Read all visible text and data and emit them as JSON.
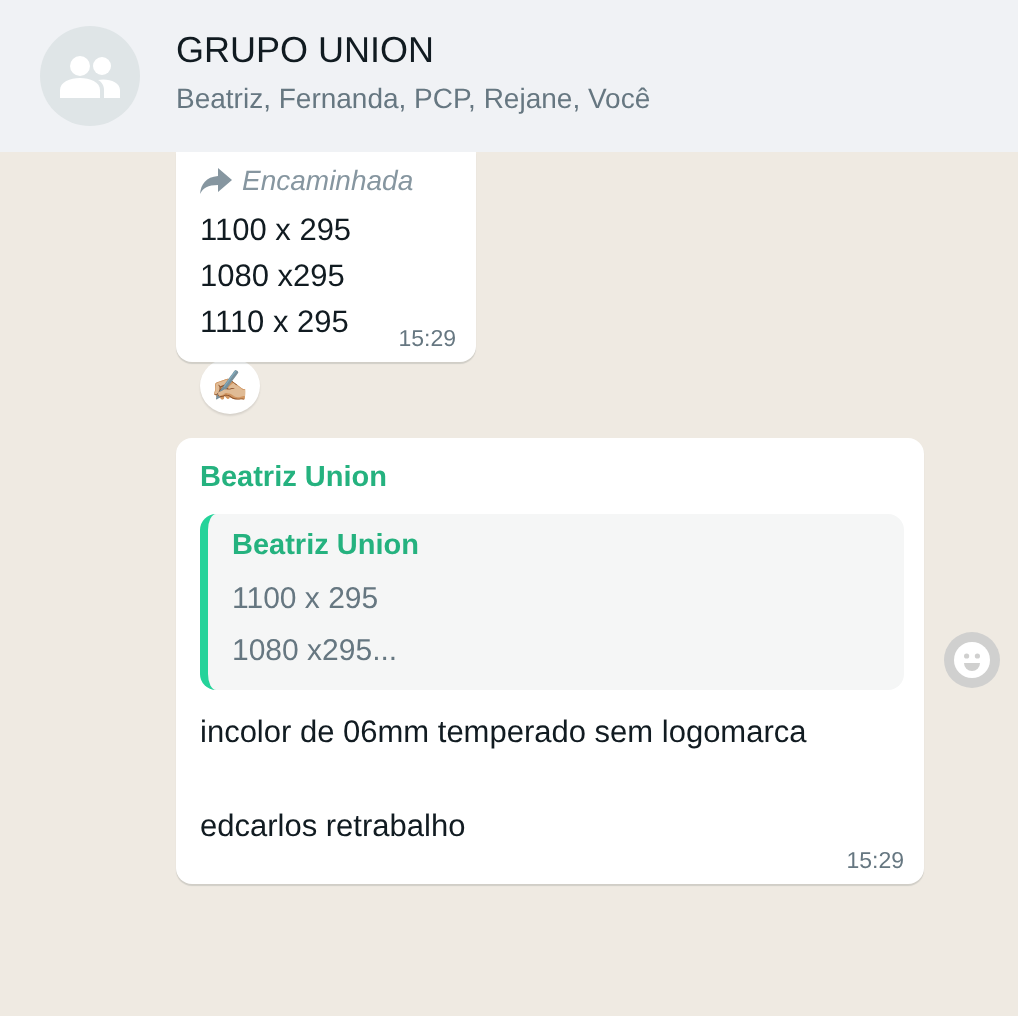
{
  "header": {
    "title": "GRUPO UNION",
    "members": "Beatriz, Fernanda, PCP, Rejane, Você"
  },
  "messages": [
    {
      "kind": "forwarded",
      "forward_label": "Encaminhada",
      "lines": [
        "1100 x 295",
        "1080 x295",
        "1110 x 295"
      ],
      "time": "15:29",
      "reaction": "✍🏼"
    },
    {
      "kind": "reply",
      "sender": "Beatriz Union",
      "quote": {
        "sender": "Beatriz Union",
        "lines": [
          "1100 x 295",
          "1080 x295..."
        ]
      },
      "text": "incolor de 06mm temperado sem logomarca\n\nedcarlos retrabalho",
      "time": "15:29"
    }
  ]
}
